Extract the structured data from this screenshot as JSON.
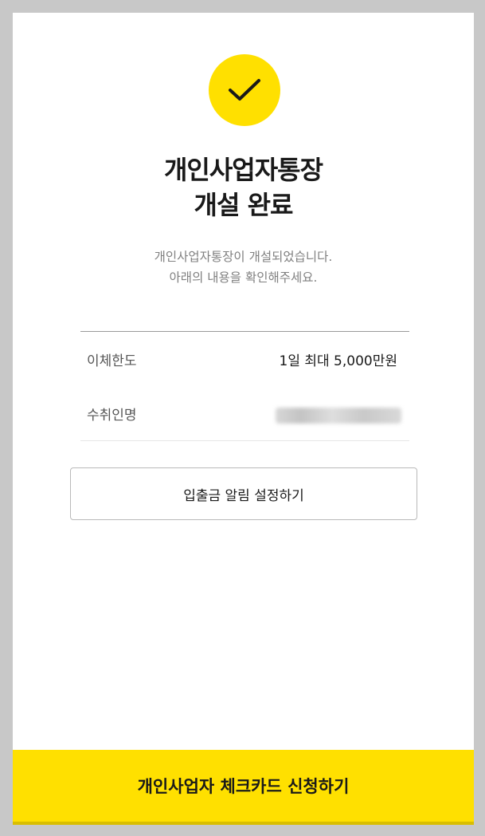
{
  "header": {
    "title_line1": "개인사업자통장",
    "title_line2": "개설 완료"
  },
  "description": {
    "line1": "개인사업자통장이 개설되었습니다.",
    "line2": "아래의 내용을 확인해주세요."
  },
  "info": {
    "rows": [
      {
        "label": "이체한도",
        "value": "1일 최대 5,000만원"
      },
      {
        "label": "수취인명",
        "value": ""
      }
    ]
  },
  "buttons": {
    "alarm_label": "입출금 알림 설정하기",
    "apply_label": "개인사업자 체크카드 신청하기"
  },
  "colors": {
    "accent": "#ffe000",
    "text": "#191919",
    "subtext": "#808080"
  },
  "icons": {
    "status": "checkmark-icon"
  }
}
